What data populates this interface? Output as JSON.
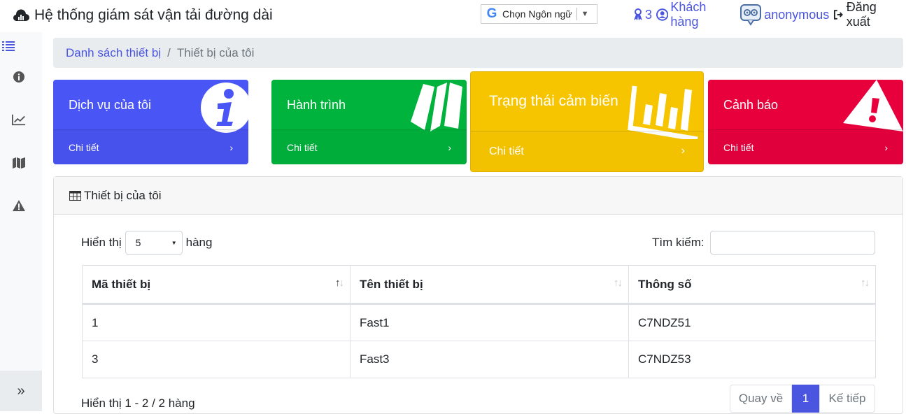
{
  "header": {
    "app_title": "Hệ thống giám sát vận tải đường dài",
    "language_label": "Chọn Ngôn ngữ",
    "users_count": "3",
    "customer_label": "Khách hàng",
    "username": "anonymous",
    "logout_label": "Đăng xuất"
  },
  "sidebar": {
    "icons": [
      "list-icon",
      "info-icon",
      "chart-line-icon",
      "map-icon",
      "warning-icon"
    ],
    "collapse_label": "»"
  },
  "breadcrumb": {
    "parent": "Danh sách thiết bị",
    "separator": "/",
    "current": "Thiết bị của tôi"
  },
  "cards": [
    {
      "title": "Dịch vụ của tôi",
      "detail": "Chi tiết",
      "color": "#4a55f5",
      "icon": "info-icon"
    },
    {
      "title": "Hành trình",
      "detail": "Chi tiết",
      "color": "#00b33c",
      "icon": "map-icon"
    },
    {
      "title": "Trạng thái cảm biến",
      "detail": "Chi tiết",
      "color": "#f7c500",
      "icon": "chart-bar-icon"
    },
    {
      "title": "Cảnh báo",
      "detail": "Chi tiết",
      "color": "#e8003d",
      "icon": "warning-icon"
    }
  ],
  "panel": {
    "title": "Thiết bị của tôi",
    "show_label": "Hiển thị",
    "page_size": "5",
    "rows_label": "hàng",
    "search_label": "Tìm kiếm:",
    "columns": [
      "Mã thiết bị",
      "Tên thiết bị",
      "Thông số"
    ],
    "rows": [
      [
        "1",
        "Fast1",
        "C7NDZ51"
      ],
      [
        "3",
        "Fast3",
        "C7NDZ53"
      ]
    ],
    "info": "Hiển thị 1 - 2 / 2 hàng",
    "prev_label": "Quay về",
    "current_page": "1",
    "next_label": "Kế tiếp"
  }
}
